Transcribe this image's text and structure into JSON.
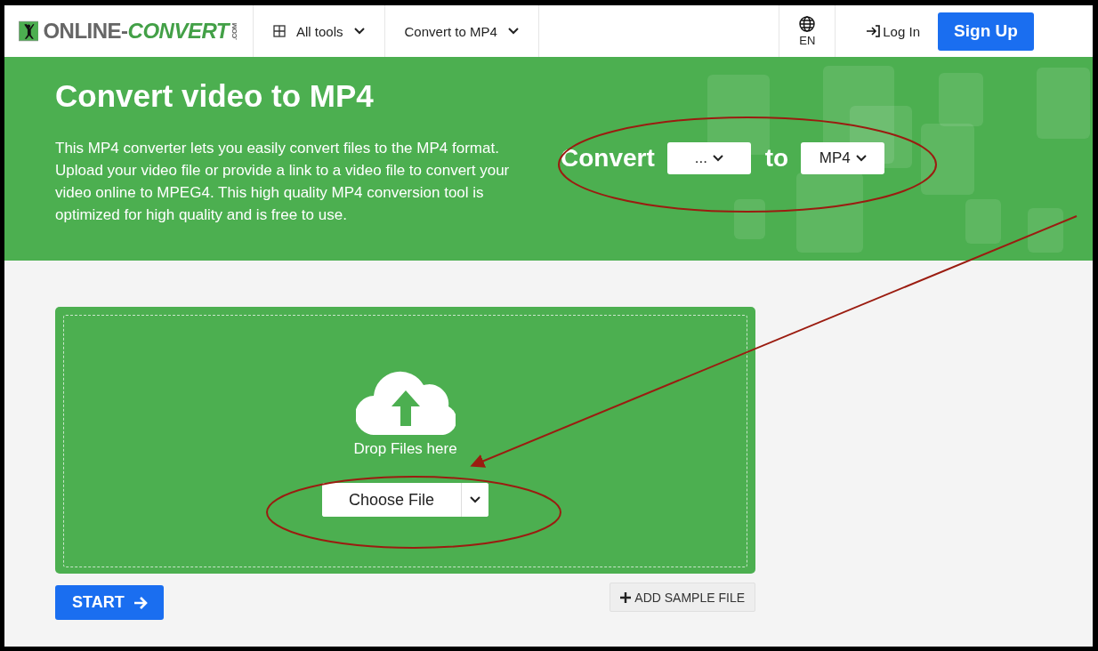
{
  "header": {
    "logo": {
      "text_a": "ONLINE-",
      "text_b": "CONVERT",
      "text_c": ".COM"
    },
    "nav": [
      {
        "label": "All tools",
        "kind": "grid"
      },
      {
        "label": "Convert to MP4",
        "kind": "plain"
      }
    ],
    "language": "EN",
    "login": "Log In",
    "signup": "Sign Up"
  },
  "banner": {
    "title": "Convert video to MP4",
    "description": "This MP4 converter lets you easily convert files to the MP4 format. Upload your video file or provide a link to a video file to convert your video online to MPEG4. This high quality MP4 conversion tool is optimized for high quality and is free to use.",
    "convert_label": "Convert",
    "from": "...",
    "to_label": "to",
    "to": "MP4"
  },
  "upload": {
    "drop_text": "Drop Files here",
    "choose_button": "Choose File"
  },
  "start_button": "START",
  "sample_button": "ADD SAMPLE FILE",
  "annotations": [
    {
      "kind": "ellipse"
    },
    {
      "kind": "ellipse"
    },
    {
      "kind": "arrow"
    }
  ]
}
